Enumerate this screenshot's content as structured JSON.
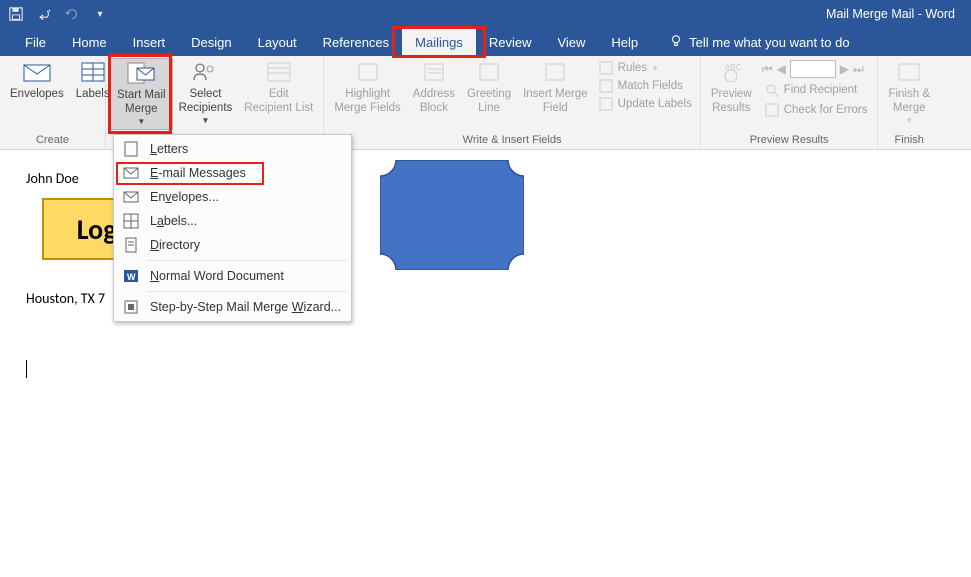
{
  "window": {
    "title": "Mail Merge Mail  -  Word"
  },
  "qat": {
    "save": "Save",
    "undo": "Undo",
    "redo": "Redo",
    "customize": "Customize"
  },
  "tabs": {
    "file": "File",
    "home": "Home",
    "insert": "Insert",
    "design": "Design",
    "layout": "Layout",
    "references": "References",
    "mailings": "Mailings",
    "review": "Review",
    "view": "View",
    "help": "Help",
    "tellme": "Tell me what you want to do"
  },
  "ribbon": {
    "create": {
      "label": "Create",
      "envelopes": "Envelopes",
      "labels": "Labels"
    },
    "start": {
      "start_mail_merge": "Start Mail\nMerge",
      "select_recipients": "Select\nRecipients",
      "edit_recipient_list": "Edit\nRecipient List"
    },
    "write": {
      "label": "Write & Insert Fields",
      "highlight": "Highlight\nMerge Fields",
      "address_block": "Address\nBlock",
      "greeting_line": "Greeting\nLine",
      "insert_merge_field": "Insert Merge\nField",
      "rules": "Rules",
      "match_fields": "Match Fields",
      "update_labels": "Update Labels"
    },
    "preview": {
      "label": "Preview Results",
      "preview_results": "Preview\nResults",
      "find_recipient": "Find Recipient",
      "check_errors": "Check for Errors",
      "record": ""
    },
    "finish": {
      "label": "Finish",
      "finish_merge": "Finish &\nMerge"
    }
  },
  "dropdown": {
    "letters": "Letters",
    "email": "E-mail Messages",
    "envelopes": "Envelopes...",
    "labels": "Labels...",
    "directory": "Directory",
    "normal": "Normal Word Document",
    "wizard": "Step-by-Step Mail Merge Wizard..."
  },
  "document": {
    "name": "John Doe",
    "logo": "Logo",
    "address": "Houston, TX 7"
  }
}
